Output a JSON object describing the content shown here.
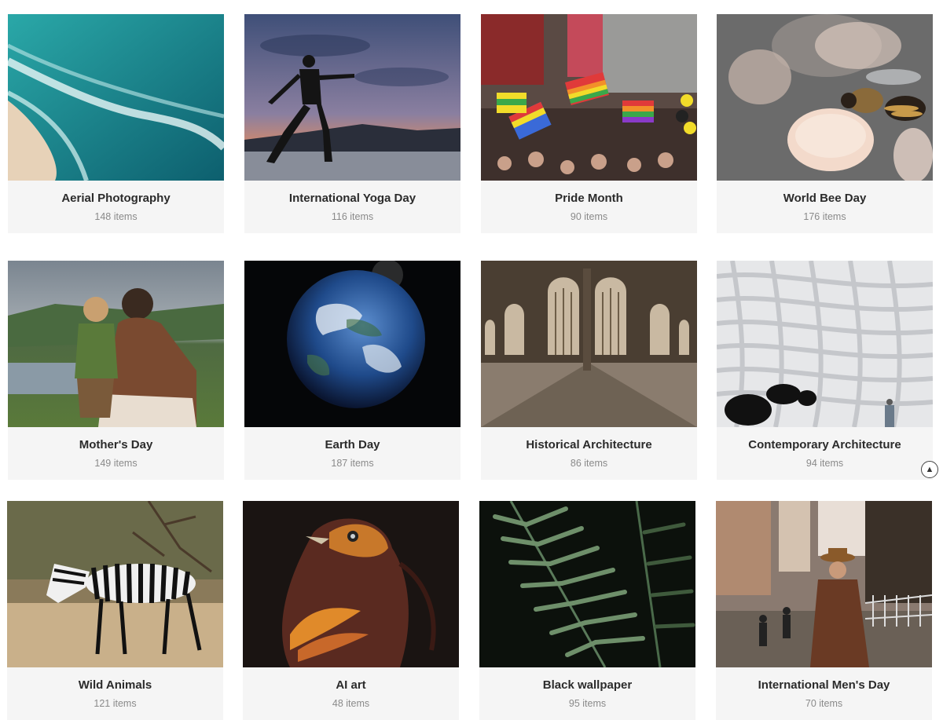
{
  "collections": [
    {
      "title": "Aerial Photography",
      "count": "148 items"
    },
    {
      "title": "International Yoga Day",
      "count": "116 items"
    },
    {
      "title": "Pride Month",
      "count": "90 items"
    },
    {
      "title": "World Bee Day",
      "count": "176 items"
    },
    {
      "title": "Mother's Day",
      "count": "149 items"
    },
    {
      "title": "Earth Day",
      "count": "187 items"
    },
    {
      "title": "Historical Architecture",
      "count": "86 items"
    },
    {
      "title": "Contemporary Architecture",
      "count": "94 items"
    },
    {
      "title": "Wild Animals",
      "count": "121 items"
    },
    {
      "title": "AI art",
      "count": "48 items"
    },
    {
      "title": "Black wallpaper",
      "count": "95 items"
    },
    {
      "title": "International Men's Day",
      "count": "70 items"
    }
  ],
  "scroll_top": {
    "icon": "arrow-up-icon",
    "glyph": "▲"
  }
}
